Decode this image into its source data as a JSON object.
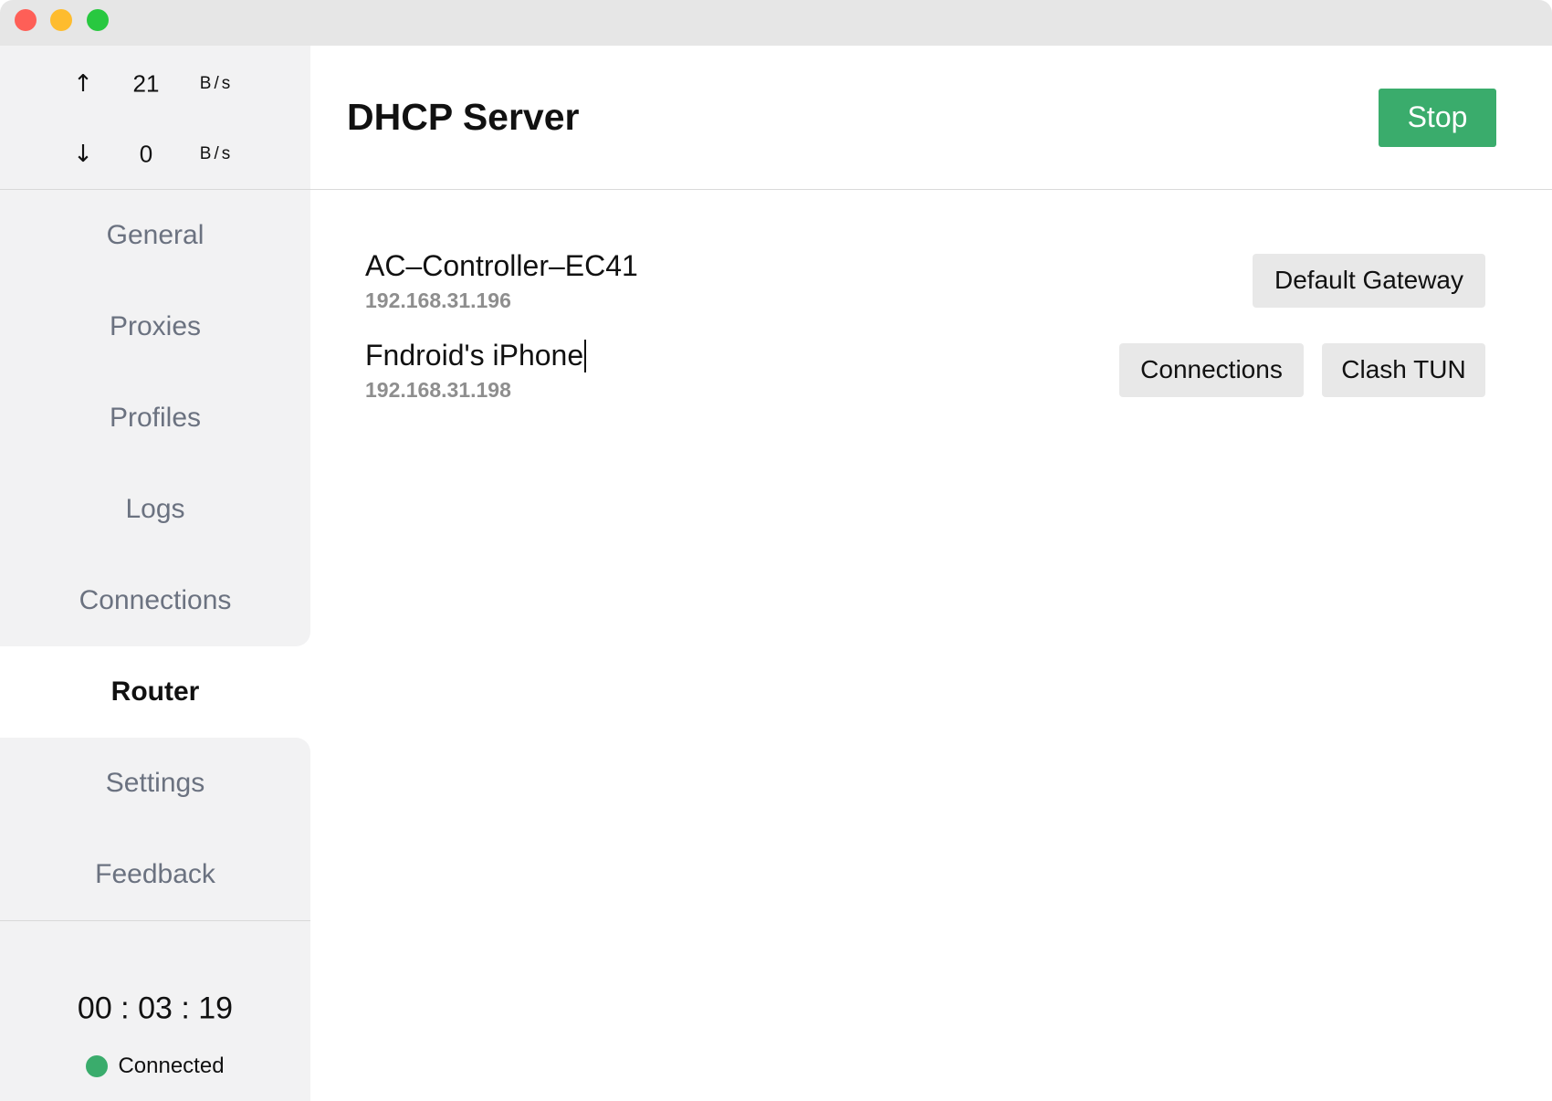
{
  "window": {
    "controls": [
      {
        "icon": "close-window-icon",
        "color": "#fe5f57"
      },
      {
        "icon": "minimize-window-icon",
        "color": "#febc2e"
      },
      {
        "icon": "zoom-window-icon",
        "color": "#28c840"
      }
    ]
  },
  "traffic": {
    "upload": {
      "icon": "upload-arrow-icon",
      "glyph": "↑",
      "value": "21",
      "unit": "B/s"
    },
    "download": {
      "icon": "download-arrow-icon",
      "glyph": "↓",
      "value": "0",
      "unit": "B/s"
    }
  },
  "nav": {
    "items": [
      {
        "label": "General",
        "active": false
      },
      {
        "label": "Proxies",
        "active": false
      },
      {
        "label": "Profiles",
        "active": false
      },
      {
        "label": "Logs",
        "active": false
      },
      {
        "label": "Connections",
        "active": false
      },
      {
        "label": "Router",
        "active": true
      },
      {
        "label": "Settings",
        "active": false
      },
      {
        "label": "Feedback",
        "active": false
      }
    ]
  },
  "status": {
    "uptime": "00 : 03 : 19",
    "state": "Connected",
    "state_color": "#3aac6c"
  },
  "main": {
    "title": "DHCP Server",
    "action_button": "Stop"
  },
  "devices": [
    {
      "name": "AC–Controller–EC41",
      "ip": "192.168.31.196",
      "actions": [
        "Default Gateway"
      ]
    },
    {
      "name": "Fndroid's iPhone",
      "ip": "192.168.31.198",
      "actions": [
        "Connections",
        "Clash TUN"
      ],
      "editing": true
    }
  ],
  "colors": {
    "accent": "#3aac6c",
    "sidebar_bg": "#f2f2f3",
    "titlebar_bg": "#e6e6e6",
    "nav_text": "#6b7280",
    "button_bg": "#e8e8e8"
  }
}
